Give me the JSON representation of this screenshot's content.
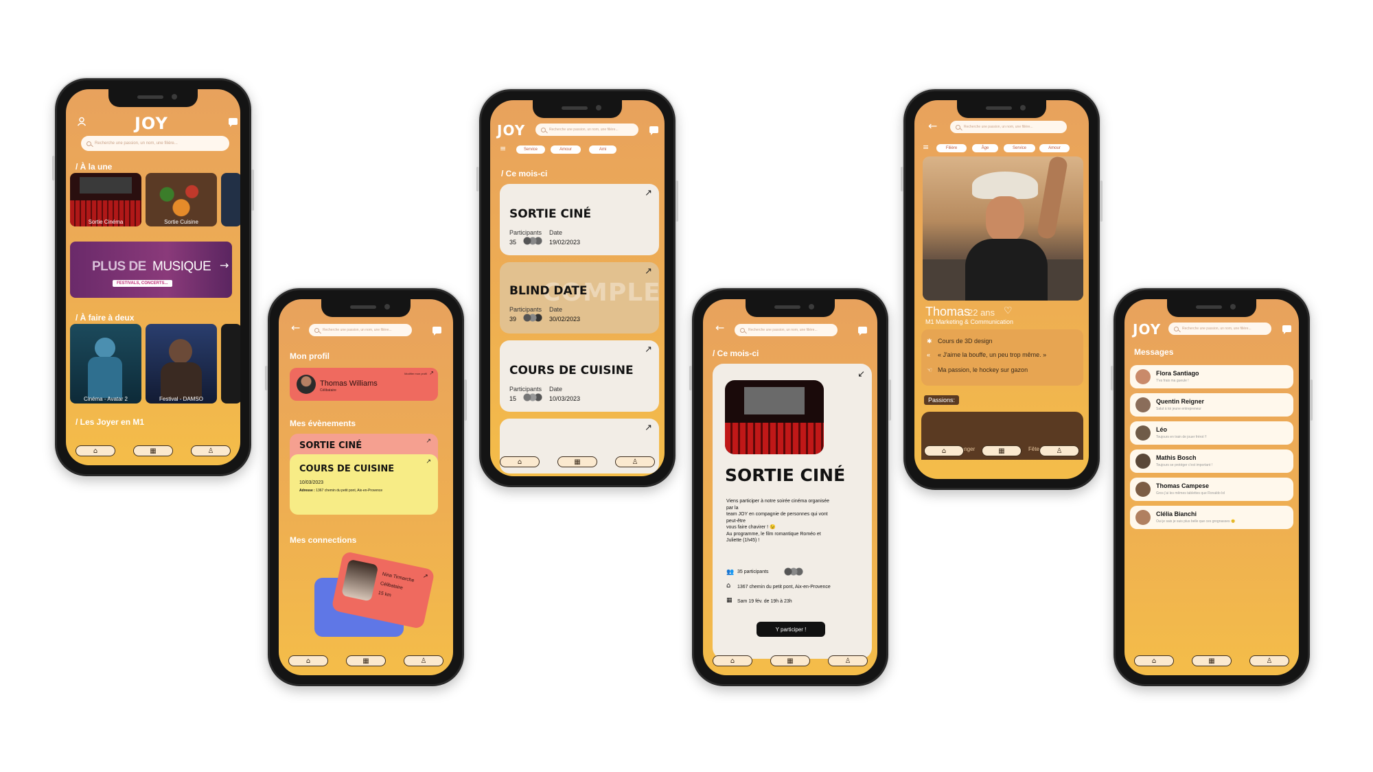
{
  "brand": {
    "logo": "JOY"
  },
  "search": {
    "placeholder": "Recherche une passion, un nom, une filière..."
  },
  "home": {
    "section_featured": "/ À la une",
    "featured": [
      {
        "caption": "Sortie Cinéma"
      },
      {
        "caption": "Sortie Cuisine"
      }
    ],
    "banner_left": "PLUS DE",
    "banner_right": "MUSIQUE",
    "banner_sub": "FESTIVALS, CONCERTS...",
    "section_duo": "/ À faire à deux",
    "duo": [
      {
        "caption": "Cinéma - Avatar 2"
      },
      {
        "caption": "Festival - DAMSO"
      }
    ],
    "section_joyers": "/ Les Joyer en M1"
  },
  "profile": {
    "section_profile": "Mon profil",
    "user_name": "Thomas Williams",
    "user_status": "Célibataire",
    "edit_link": "Modifier mon profil",
    "section_events": "Mes évènements",
    "event1_title": "SORTIE CINÉ",
    "event2_title": "COURS DE CUISINE",
    "event2_date": "10/03/2023",
    "event2_address_label": "Adresse :",
    "event2_address": "1367 chemin du petit pont, Aix-en-Provence",
    "section_connections": "Mes connections",
    "conn_name": "Nina Tirmarche",
    "conn_status": "Célibataire",
    "conn_distance": "15 km"
  },
  "events_list": {
    "filters": [
      "Service",
      "Amour",
      "Ami"
    ],
    "section": "/ Ce mois-ci",
    "participants_label": "Participants",
    "date_label": "Date",
    "cards": [
      {
        "title": "SORTIE CINÉ",
        "participants": "35",
        "date": "19/02/2023",
        "color": "#f2ede6"
      },
      {
        "title": "BLIND DATE",
        "participants": "39",
        "date": "30/02/2023",
        "color": "#e2c18f",
        "watermark": "COMPLET"
      },
      {
        "title": "COURS DE CUISINE",
        "participants": "15",
        "date": "10/03/2023",
        "color": "#f2ede6"
      }
    ]
  },
  "event_detail": {
    "section": "/ Ce mois-ci",
    "title": "SORTIE CINÉ",
    "desc_lines": [
      "Viens participer à notre soirée cinéma organisée",
      "par la",
      "team JOY en compagnie de personnes qui vont",
      "peut-être",
      "vous faire chavirer ! 😉",
      "Au programme, le film romantique Roméo et",
      "Juliette (1h45) !"
    ],
    "participants": "35 participants",
    "address": "1367 chemin du petit pont, Aix-en-Provence",
    "schedule": "Sam 19 fév. de 19h à 23h",
    "cta": "Y participer !"
  },
  "user_profile": {
    "filters": [
      "Filière",
      "Âge",
      "Service",
      "Amour"
    ],
    "name": "Thomas",
    "age": "22 ans",
    "program": "M1 Marketing & Communication",
    "info1": "Cours de 3D design",
    "quote": "« J'aime la bouffe, un peu trop même. »",
    "info3": "Ma passion, le hockey sur gazon",
    "passions_label": "Passions:",
    "bottom_labels": [
      "Echanger",
      "Fête"
    ]
  },
  "messages": {
    "title": "Messages",
    "items": [
      {
        "name": "Flora Santiago",
        "preview": "T'es frais ma gueule !",
        "color": "#c98a6a"
      },
      {
        "name": "Quentin Reigner",
        "preview": "Salut à toi jeune entrepreneur",
        "color": "#8a6d5a"
      },
      {
        "name": "Léo",
        "preview": "Toujours en train de jouer frérot !!",
        "color": "#6f5b48"
      },
      {
        "name": "Mathis Bosch",
        "preview": "Toujours se protéger c'est important !",
        "color": "#5a4838"
      },
      {
        "name": "Thomas Campese",
        "preview": "Gros j'ai les mêmes tablettes que Ronaldo lol",
        "color": "#7c5d44"
      },
      {
        "name": "Clélia Bianchi",
        "preview": "Oui je sais je suis plus belle que ces grognasses 😊",
        "color": "#b08060"
      }
    ]
  }
}
